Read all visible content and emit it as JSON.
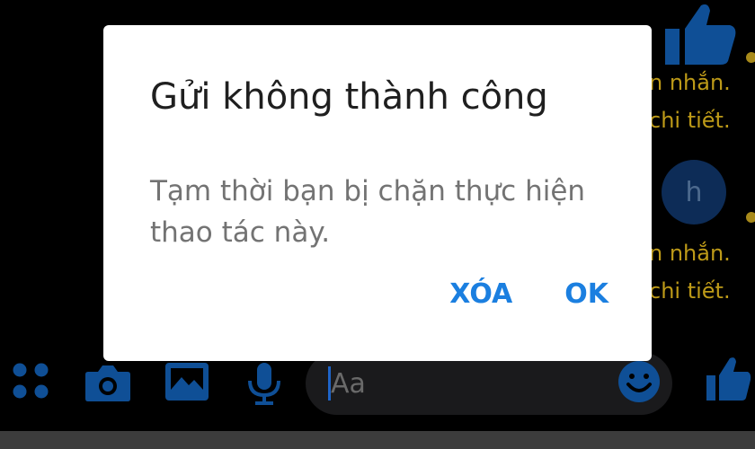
{
  "dialog": {
    "title": "Gửi không thành công",
    "message": "Tạm thời bạn bị chặn thực hiện thao tác này.",
    "buttons": {
      "delete_label": "XÓA",
      "ok_label": "OK"
    }
  },
  "background_chat": {
    "avatar_letter": "h",
    "snippets": [
      "n nhắn.",
      "chi tiết.",
      "n nhắn.",
      "chi tiết."
    ]
  },
  "composer": {
    "placeholder": "Aa",
    "icons": [
      "menu-grid-icon",
      "camera-icon",
      "image-icon",
      "microphone-icon",
      "emoji-icon",
      "thumbs-up-icon"
    ]
  },
  "colors": {
    "accent_blue": "#1b7fe0",
    "dim_icon_blue": "#0f4f96",
    "snippet_gold": "#bd9a18",
    "dialog_bg": "#ffffff",
    "screen_bg": "#000000"
  }
}
